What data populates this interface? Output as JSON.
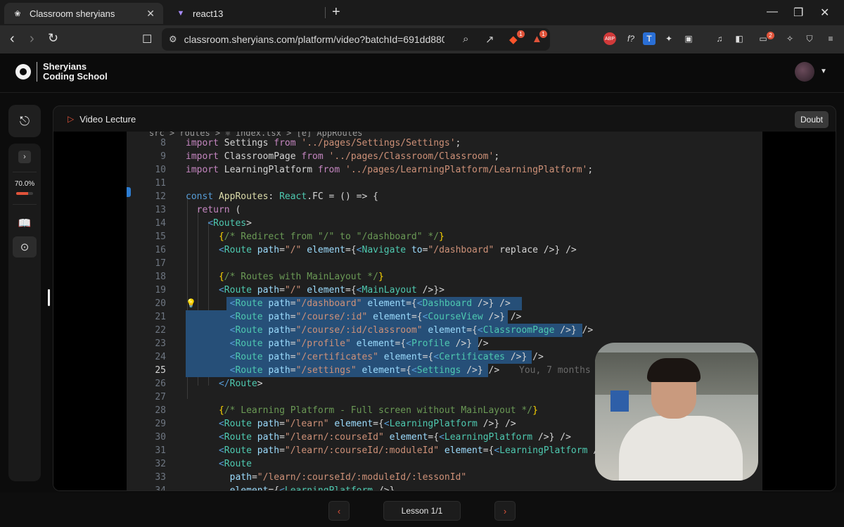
{
  "browser": {
    "tabs": [
      {
        "title": "Classroom sheryians",
        "active": true
      },
      {
        "title": "react13",
        "active": false
      }
    ],
    "new_tab": "+",
    "url": "classroom.sheryians.com/platform/video?batchId=691dd880a4...",
    "extension_badges": {
      "brave": "1",
      "alert": "1",
      "wallet": "2"
    }
  },
  "site": {
    "brand_line1": "Sheryians",
    "brand_line2": "Coding School"
  },
  "rail": {
    "progress_text": "70.0%",
    "progress_value": 0.7
  },
  "panel": {
    "title": "Video Lecture",
    "doubt_label": "Doubt"
  },
  "editor": {
    "breadcrumb": "src > routes > ⚛ index.tsx > [e] AppRoutes",
    "blame": "You, 7 months",
    "lines": [
      {
        "n": "8",
        "text": "import Settings from '../pages/Settings/Settings';"
      },
      {
        "n": "9",
        "text": "import ClassroomPage from '../pages/Classroom/Classroom';"
      },
      {
        "n": "10",
        "text": "import LearningPlatform from '../pages/LearningPlatform/LearningPlatform';"
      },
      {
        "n": "11",
        "text": ""
      },
      {
        "n": "12",
        "text": "const AppRoutes: React.FC = () => {"
      },
      {
        "n": "13",
        "text": "  return ("
      },
      {
        "n": "14",
        "text": "    <Routes>"
      },
      {
        "n": "15",
        "text": "      {/* Redirect from \"/\" to \"/dashboard\" */}"
      },
      {
        "n": "16",
        "text": "      <Route path=\"/\" element={<Navigate to=\"/dashboard\" replace />} />"
      },
      {
        "n": "17",
        "text": ""
      },
      {
        "n": "18",
        "text": "      {/* Routes with MainLayout */}"
      },
      {
        "n": "19",
        "text": "      <Route path=\"/\" element={<MainLayout />}>"
      },
      {
        "n": "20",
        "text": "        <Route path=\"/dashboard\" element={<Dashboard />} />"
      },
      {
        "n": "21",
        "text": "        <Route path=\"/course/:id\" element={<CourseView />} />"
      },
      {
        "n": "22",
        "text": "        <Route path=\"/course/:id/classroom\" element={<ClassroomPage />} />"
      },
      {
        "n": "23",
        "text": "        <Route path=\"/profile\" element={<Profile />} />"
      },
      {
        "n": "24",
        "text": "        <Route path=\"/certificates\" element={<Certificates />} />"
      },
      {
        "n": "25",
        "text": "        <Route path=\"/settings\" element={<Settings />} />"
      },
      {
        "n": "26",
        "text": "      </Route>"
      },
      {
        "n": "27",
        "text": ""
      },
      {
        "n": "28",
        "text": "      {/* Learning Platform - Full screen without MainLayout */}"
      },
      {
        "n": "29",
        "text": "      <Route path=\"/learn\" element={<LearningPlatform />} />"
      },
      {
        "n": "30",
        "text": "      <Route path=\"/learn/:courseId\" element={<LearningPlatform />} />"
      },
      {
        "n": "31",
        "text": "      <Route path=\"/learn/:courseId/:moduleId\" element={<LearningPlatform />}"
      },
      {
        "n": "32",
        "text": "      <Route"
      },
      {
        "n": "33",
        "text": "        path=\"/learn/:courseId/:moduleId/:lessonId\""
      },
      {
        "n": "34",
        "text": "        element={<LearningPlatform />}"
      }
    ]
  },
  "footer": {
    "prev": "‹",
    "next": "›",
    "lesson_label": "Lesson 1/1"
  }
}
